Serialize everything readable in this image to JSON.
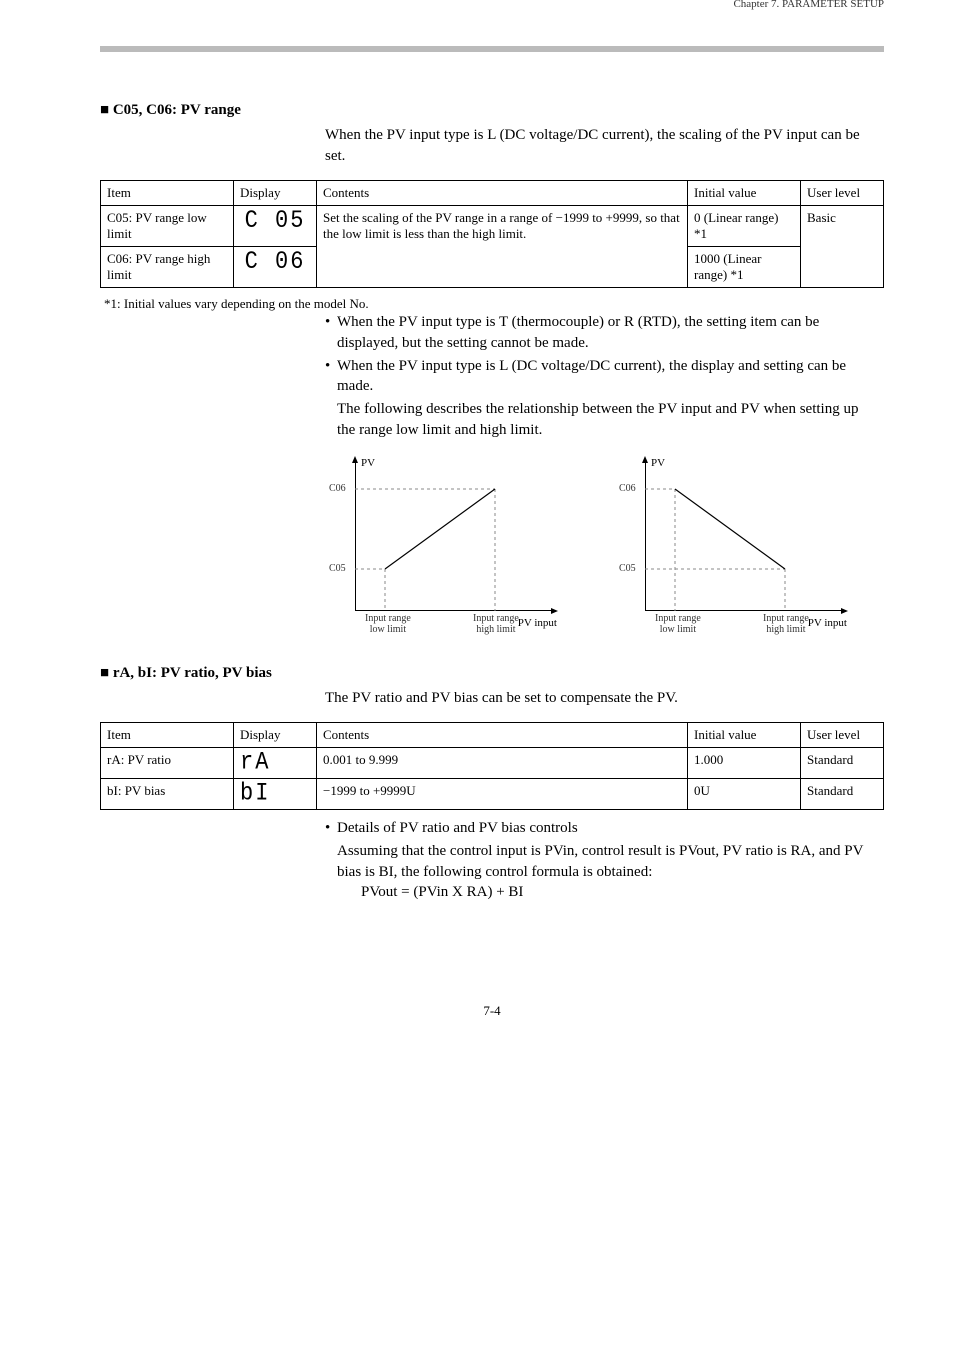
{
  "chapter": "Chapter 7. PARAMETER SETUP",
  "sections": {
    "c05c06": {
      "title": "C05, C06: PV range",
      "intro": "When the PV input type is L (DC voltage/DC current), the scaling of the PV input can be set.",
      "table": {
        "headers": {
          "item": "Item",
          "display": "Display",
          "contents": "Contents",
          "initial": "Initial value",
          "user": "User level"
        },
        "rows": [
          {
            "item": "C05: PV range low limit",
            "seg": "C  05",
            "contents": "Set the scaling of the PV range in a range of −1999 to +9999, so that the low limit is less than the high limit.",
            "initial": "0 (Linear range) *1",
            "user": "Basic"
          },
          {
            "item": "C06: PV range high limit",
            "seg": "C  06",
            "contents": "",
            "initial": "1000 (Linear range) *1",
            "user": ""
          }
        ],
        "footnote": "*1: Initial values vary depending on the model No."
      },
      "bullets": [
        "When the PV input type is T (thermocouple) or R (RTD), the setting item can be displayed, but the setting cannot be made.",
        "When the PV input type is L (DC voltage/DC current), the display and setting can be made."
      ],
      "followup": "The following describes the relationship between the PV input and PV when setting up the range low limit and high limit."
    },
    "rAbi": {
      "title": "rA, bI: PV ratio, PV bias",
      "intro": "The PV ratio and PV bias can be set to compensate the PV.",
      "table": {
        "headers": {
          "item": "Item",
          "display": "Display",
          "contents": "Contents",
          "initial": "Initial value",
          "user": "User level"
        },
        "rows": [
          {
            "item": "rA: PV ratio",
            "seg": "rA",
            "contents": "0.001 to 9.999",
            "initial": "1.000",
            "user": "Standard"
          },
          {
            "item": "bI: PV bias",
            "seg": "bI",
            "contents": "−1999 to +9999U",
            "initial": "0U",
            "user": "Standard"
          }
        ]
      },
      "bullets_title": "Details of PV ratio and PV bias controls",
      "detail1": "Assuming that the control input is PVin, control result is PVout, PV ratio is RA, and PV bias is BI, the following control formula is obtained:",
      "formula": "PVout = (PVin X RA) + BI"
    }
  },
  "diagram": {
    "ylabel": "PV",
    "xlabel": "PV input",
    "ticks": {
      "c05": "C05",
      "c06": "C06",
      "low": "Input range\nlow limit",
      "high": "Input range\nhigh limit"
    }
  },
  "chart_data": [
    {
      "type": "line",
      "title": "PV vs PV input (C05 < C06)",
      "xlabel": "PV input",
      "ylabel": "PV",
      "x": [
        "Input range low limit",
        "Input range high limit"
      ],
      "y": [
        "C05",
        "C06"
      ],
      "note": "ascending linear mapping"
    },
    {
      "type": "line",
      "title": "PV vs PV input (C05 > C06 style / descending)",
      "xlabel": "PV input",
      "ylabel": "PV",
      "x": [
        "Input range low limit",
        "Input range high limit"
      ],
      "y": [
        "C06 (high)",
        "C05 (low)"
      ],
      "note": "descending linear mapping"
    }
  ],
  "page_number": "7-4"
}
